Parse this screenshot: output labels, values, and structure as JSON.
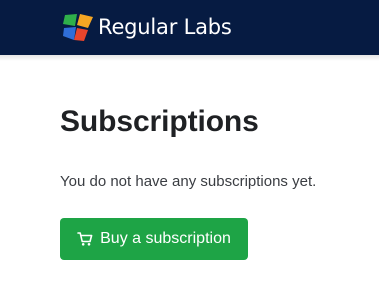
{
  "header": {
    "brand_name": "Regular Labs",
    "background_color": "#061b42",
    "logo_icon": "regular-labs-logo-icon"
  },
  "main": {
    "title": "Subscriptions",
    "empty_message": "You do not have any subscriptions yet.",
    "buy_button": {
      "label": "Buy a subscription",
      "icon": "cart-icon",
      "color": "#1ea446"
    }
  }
}
